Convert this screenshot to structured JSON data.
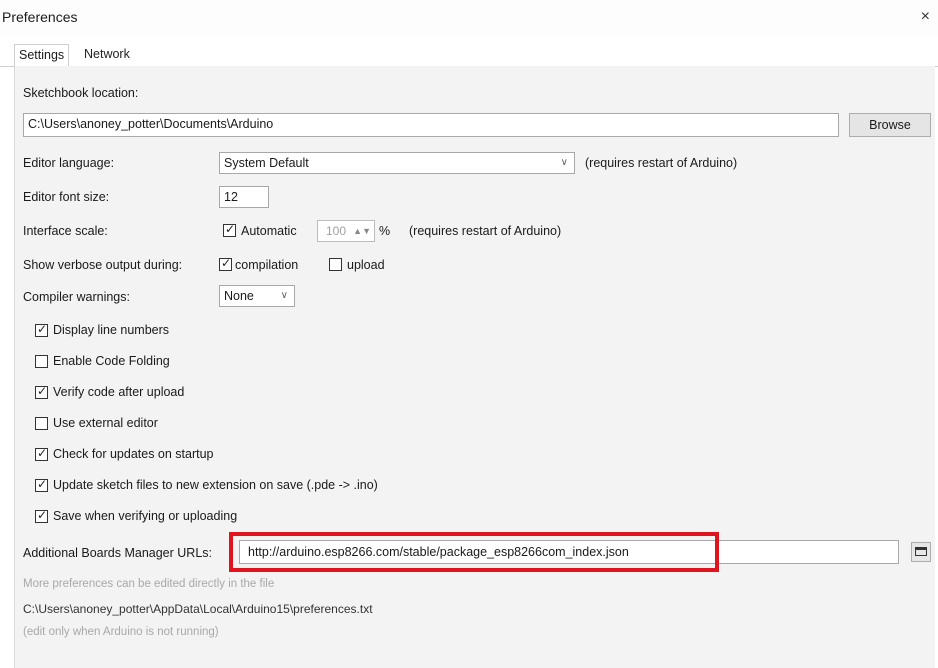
{
  "window": {
    "title": "Preferences",
    "close_glyph": "×"
  },
  "tabs": [
    {
      "label": "Settings"
    },
    {
      "label": "Network"
    }
  ],
  "settings": {
    "sketchbook_label": "Sketchbook location:",
    "sketchbook_path": "C:\\Users\\anoney_potter\\Documents\\Arduino",
    "browse_label": "Browse",
    "editor_language_label": "Editor language:",
    "editor_language_value": "System Default",
    "editor_language_note": "(requires restart of Arduino)",
    "font_size_label": "Editor font size:",
    "font_size_value": "12",
    "interface_scale_label": "Interface scale:",
    "automatic_label": "Automatic",
    "scale_value": "100",
    "scale_unit": "%",
    "interface_scale_note": "(requires restart of Arduino)",
    "verbose_label": "Show verbose output during:",
    "compilation_label": "compilation",
    "upload_label": "upload",
    "warnings_label": "Compiler warnings:",
    "warnings_value": "None",
    "options": [
      {
        "label": "Display line numbers",
        "checked": true
      },
      {
        "label": "Enable Code Folding",
        "checked": false
      },
      {
        "label": "Verify code after upload",
        "checked": true
      },
      {
        "label": "Use external editor",
        "checked": false
      },
      {
        "label": "Check for updates on startup",
        "checked": true
      },
      {
        "label": "Update sketch files to new extension on save (.pde -> .ino)",
        "checked": true
      },
      {
        "label": "Save when verifying or uploading",
        "checked": true
      }
    ],
    "boards_url_label": "Additional Boards Manager URLs:",
    "boards_url_value": "http://arduino.esp8266.com/stable/package_esp8266com_index.json",
    "more_prefs_note": "More preferences can be edited directly in the file",
    "prefs_path": "C:\\Users\\anoney_potter\\AppData\\Local\\Arduino15\\preferences.txt",
    "edit_note": "(edit only when Arduino is not running)"
  },
  "colors": {
    "highlight": "#e0141d",
    "panel_bg": "#f3f3f3"
  },
  "icons": {
    "checkbox_check": "check-icon",
    "dropdown": "chevron-down-icon",
    "url_editor": "window-icon"
  }
}
